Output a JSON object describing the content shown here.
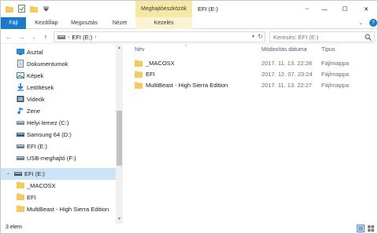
{
  "window": {
    "title": "EFI (E:)",
    "context_group": "Meghajtóeszközök",
    "controls": {
      "minimize": "—",
      "maximize": "☐",
      "close": "✕"
    }
  },
  "ribbon": {
    "tabs": [
      {
        "label": "Fájl",
        "active": true
      },
      {
        "label": "Kezdőlap"
      },
      {
        "label": "Megosztás"
      },
      {
        "label": "Nézet"
      },
      {
        "label": "Kezelés",
        "context": true
      }
    ]
  },
  "address": {
    "crumbs": [
      "EFI (E:)"
    ],
    "search_placeholder": "Keresés: EFI (E:)"
  },
  "sidebar": {
    "items": [
      {
        "label": "Asztal",
        "icon": "desktop-icon"
      },
      {
        "label": "Dokumentumok",
        "icon": "documents-icon"
      },
      {
        "label": "Képek",
        "icon": "pictures-icon"
      },
      {
        "label": "Letöltések",
        "icon": "downloads-icon"
      },
      {
        "label": "Videók",
        "icon": "videos-icon"
      },
      {
        "label": "Zene",
        "icon": "music-icon"
      },
      {
        "label": "Helyi lemez (C:)",
        "icon": "local-disk-icon"
      },
      {
        "label": "Samsung 64 (D:)",
        "icon": "drive-icon"
      },
      {
        "label": "EFI (E:)",
        "icon": "drive-icon"
      },
      {
        "label": "USB-meghajtó (F:)",
        "icon": "usb-drive-icon"
      }
    ],
    "drive": {
      "label": "EFI (E:)",
      "icon": "drive-icon",
      "selected": true
    },
    "drive_children": [
      {
        "label": "_MACOSX",
        "icon": "folder-icon"
      },
      {
        "label": "EFI",
        "icon": "folder-icon"
      },
      {
        "label": "MultiBeast - High Sierra Edition",
        "icon": "folder-icon"
      }
    ]
  },
  "columns": {
    "name": "Név",
    "date": "Módosítás dátuma",
    "type": "Típus"
  },
  "files": [
    {
      "name": "_MACOSX",
      "date": "2017. 11. 13. 22:28",
      "type": "Fájlmappa"
    },
    {
      "name": "EFI",
      "date": "2017. 12. 07. 23:24",
      "type": "Fájlmappa"
    },
    {
      "name": "MultiBeast - High Sierra Edition",
      "date": "2017. 11. 13. 22:27",
      "type": "Fájlmappa"
    }
  ],
  "status": {
    "count": "3 elem"
  },
  "colors": {
    "accent": "#1979ca",
    "context_tab": "#f8e8a6",
    "selection": "#cce4f7",
    "folder": "#f4c95d"
  }
}
